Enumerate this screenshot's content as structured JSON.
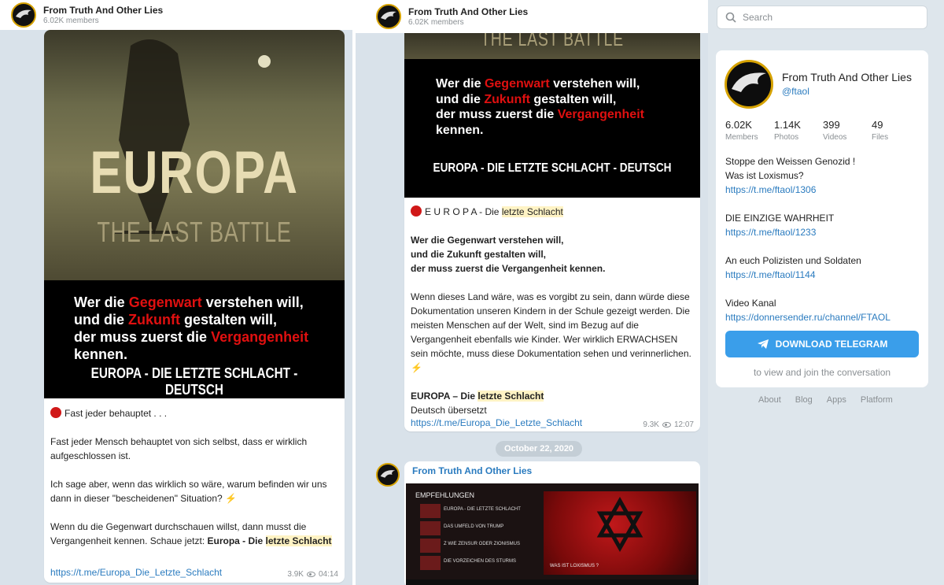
{
  "channel": {
    "name": "From Truth And Other Lies",
    "members": "6.02K members",
    "username": "@ftaol"
  },
  "colors": {
    "accent": "#2a7bbf",
    "button": "#3a9eea",
    "alert_red": "#e01010",
    "highlight": "#fff3c4"
  },
  "poster": {
    "title": "EUROPA",
    "subtitle": "THE LAST BATTLE",
    "quote_w1": "Wer die ",
    "quote_r1": "Gegenwart",
    "quote_t1": " verstehen will,",
    "quote_w2": "und die ",
    "quote_r2": "Zukunft",
    "quote_t2": " gestalten will,",
    "quote_w3": "der muss zuerst die ",
    "quote_r3": "Vergangenheit",
    "quote_t3": " kennen.",
    "footer": "EUROPA - DIE LETZTE SCHLACHT - DEUTSCH"
  },
  "left_msg": {
    "intro": "Fast jeder behauptet . . .",
    "p1": "Fast jeder Mensch behauptet von sich selbst, dass er wirklich aufgeschlossen ist.",
    "p2": "Ich sage aber, wenn das wirklich so wäre, warum befinden wir uns dann in dieser \"bescheidenen\" Situation?",
    "p3_a": "Wenn du die Gegenwart durchschauen willst, dann musst die Vergangenheit kennen. Schaue jetzt: ",
    "p3_b": "Europa - Die ",
    "p3_c": "letzte Schlacht",
    "link": "https://t.me/Europa_Die_Letzte_Schlacht",
    "views": "3.9K",
    "time": "04:14"
  },
  "mid_msg": {
    "heading_a": "E U R O P A - Die ",
    "heading_b": "letzte Schlacht",
    "bold1": "Wer die Gegenwart verstehen will,",
    "bold2": "und die Zukunft gestalten will,",
    "bold3": "der muss zuerst die Vergangenheit kennen.",
    "para": "Wenn dieses Land wäre, was es vorgibt zu sein, dann würde diese Dokumentation unseren Kindern in der Schule gezeigt werden. Die meisten Menschen auf der Welt, sind im Bezug auf die Vergangenheit ebenfalls wie Kinder. Wer wirklich ERWACHSEN sein möchte, muss diese Dokumentation sehen und verinnerlichen.",
    "title_a": "EUROPA – Die ",
    "title_b": "letzte Schlacht",
    "translated": "Deutsch übersetzt",
    "link": "https://t.me/Europa_Die_Letzte_Schlacht",
    "views": "9.3K",
    "time": "12:07"
  },
  "date_separator": "October 22, 2020",
  "next_msg": {
    "sender": "From Truth And Other Lies",
    "thumb_header": "EMPFEHLUNGEN",
    "thumb_items": [
      "EUROPA - DIE LETZTE SCHLACHT",
      "DAS UMFELD VON TRUMP",
      "Z WIE ZENSUR ODER ZIONISMUS",
      "DIE VORZEICHEN DES STURMS"
    ],
    "thumb_caption": "WAS IST LOXISMUS ?"
  },
  "search": {
    "placeholder": "Search"
  },
  "card": {
    "stats": [
      {
        "value": "6.02K",
        "label": "Members"
      },
      {
        "value": "1.14K",
        "label": "Photos"
      },
      {
        "value": "399",
        "label": "Videos"
      },
      {
        "value": "49",
        "label": "Files"
      }
    ],
    "desc1": "Stoppe den Weissen Genozid !",
    "desc2": "Was ist Loxismus?",
    "link1": "https://t.me/ftaol/1306",
    "desc3": "DIE EINZIGE WAHRHEIT",
    "link2": "https://t.me/ftaol/1233",
    "desc4": "An euch Polizisten und Soldaten",
    "link3": "https://t.me/ftaol/1144",
    "desc5": "Video Kanal",
    "link4": "https://donnersender.ru/channel/FTAOL",
    "download": "DOWNLOAD TELEGRAM",
    "join": "to view and join the conversation"
  },
  "footer_links": [
    "About",
    "Blog",
    "Apps",
    "Platform"
  ]
}
